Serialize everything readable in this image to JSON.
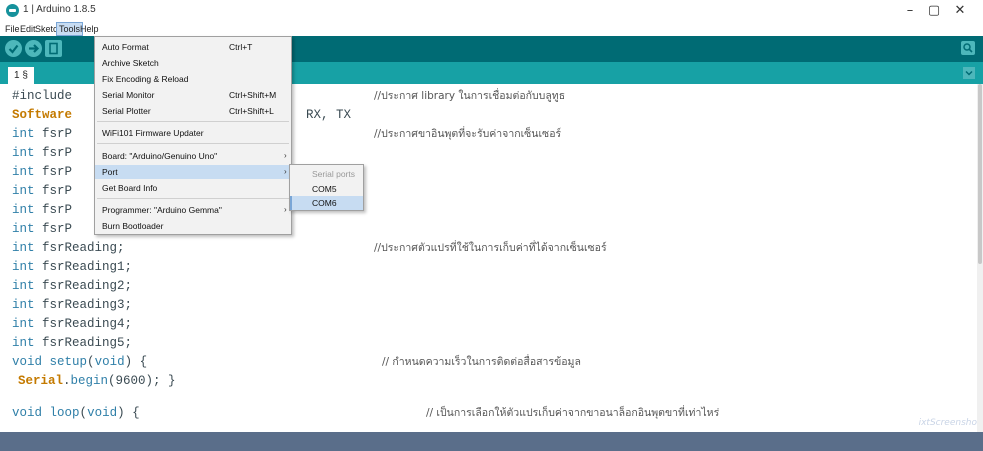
{
  "window": {
    "title": "1 | Arduino 1.8.5",
    "minimize_glyph": "–",
    "maximize_glyph": "▢",
    "close_glyph": "✕"
  },
  "menubar": {
    "items": [
      "File",
      "Edit",
      "Sketch",
      "Tools",
      "Help"
    ],
    "active": "Tools"
  },
  "toolbar": {
    "buttons": [
      "verify-icon",
      "upload-icon",
      "new-sketch-icon"
    ],
    "right_button": "serial-monitor-icon"
  },
  "tabs": {
    "main_label": "1 §"
  },
  "colors": {
    "toolbar": "#006b74",
    "tabstrip": "#17a1a5",
    "statusbar": "#5a6e8a",
    "menu_highlight": "#c7dcf2",
    "keyword": "#2f7fa8",
    "class_name": "#c47a00"
  },
  "tools_menu": {
    "auto_format": {
      "label": "Auto Format",
      "shortcut": "Ctrl+T"
    },
    "archive_sketch": {
      "label": "Archive Sketch"
    },
    "fix_encoding": {
      "label": "Fix Encoding & Reload"
    },
    "serial_monitor": {
      "label": "Serial Monitor",
      "shortcut": "Ctrl+Shift+M"
    },
    "serial_plotter": {
      "label": "Serial Plotter",
      "shortcut": "Ctrl+Shift+L"
    },
    "wifi_updater": {
      "label": "WiFi101 Firmware Updater"
    },
    "board": {
      "label": "Board: \"Arduino/Genuino Uno\"",
      "arrow": "›"
    },
    "port": {
      "label": "Port",
      "arrow": "›"
    },
    "board_info": {
      "label": "Get Board Info"
    },
    "programmer": {
      "label": "Programmer: \"Arduino Gemma\"",
      "arrow": "›"
    },
    "burn_bootloader": {
      "label": "Burn Bootloader"
    }
  },
  "port_submenu": {
    "header": "Serial ports",
    "items": [
      "COM5",
      "COM6"
    ],
    "selected": "COM6"
  },
  "editor": {
    "lines": {
      "l1": "#include",
      "l2_cls": "Software",
      "l2_rest": "RX, TX",
      "l3": "fsrP",
      "l4": "fsrP",
      "l5": "fsrP",
      "l6": "fsrP",
      "l7": "fsrP",
      "l8": "fsrP",
      "l9": "fsrReading;",
      "l10": "fsrReading1;",
      "l11": "fsrReading2;",
      "l12": "fsrReading3;",
      "l13": "fsrReading4;",
      "l14": "fsrReading5;",
      "l15_fn": "setup",
      "l15_arg": "void",
      "l15_rest": ") {",
      "l16_cls": "Serial",
      "l16_fn": "begin",
      "l16_rest": "(9600); }",
      "l18_fn": "loop",
      "l18_arg": "void",
      "l18_rest": ") {"
    },
    "keywords": {
      "int": "int",
      "void": "void"
    },
    "comments": {
      "c1": "//ประกาศ library ในการเชื่อมต่อกับบลูทูธ",
      "c2": "//ประกาศขาอินพุตที่จะรับค่าจากเซ็นเซอร์",
      "c3": "//ประกาศตัวแปรที่ใช้ในการเก็บค่าที่ได้จากเซ็นเซอร์",
      "c4": "// กำหนดความเร็วในการติดต่อสื่อสารข้อมูล",
      "c5": "// เป็นการเลือกให้ตัวแปรเก็บค่าจากขาอนาล็อกอินพุตขาที่เท่าไหร่"
    }
  },
  "watermark": "ixtScreensho"
}
